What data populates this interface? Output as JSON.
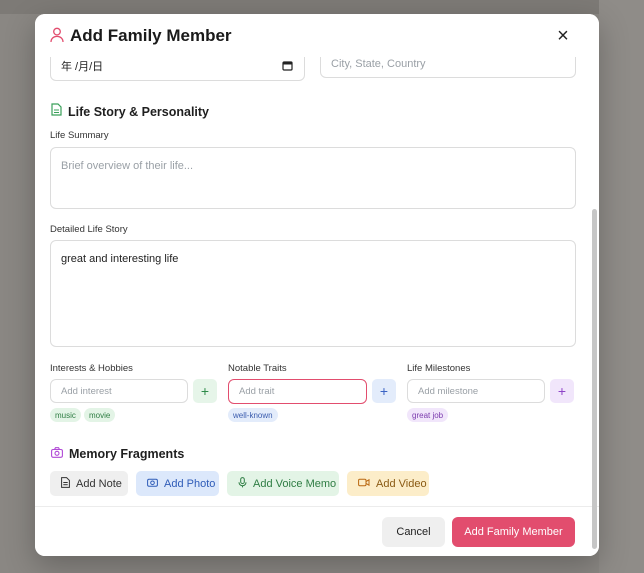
{
  "dialog": {
    "title": "Add Family Member",
    "close_label": "×"
  },
  "fields": {
    "date_value": "年 /月/日",
    "place_placeholder": "City, State, Country"
  },
  "life_story": {
    "section_title": "Life Story & Personality",
    "summary_label": "Life Summary",
    "summary_placeholder": "Brief overview of their life...",
    "detailed_label": "Detailed Life Story",
    "detailed_value": "great and interesting life"
  },
  "interests": {
    "label": "Interests & Hobbies",
    "placeholder": "Add interest",
    "add_label": "+",
    "tags": [
      "music",
      "movie"
    ]
  },
  "traits": {
    "label": "Notable Traits",
    "placeholder": "Add trait",
    "add_label": "+",
    "tags": [
      "well-known"
    ]
  },
  "milestones": {
    "label": "Life Milestones",
    "placeholder": "Add milestone",
    "add_label": "+",
    "tags": [
      "great job"
    ]
  },
  "memory": {
    "section_title": "Memory Fragments",
    "buttons": [
      "Add Note",
      "Add Photo",
      "Add Voice Memo",
      "Add Video"
    ]
  },
  "footer": {
    "cancel_label": "Cancel",
    "submit_label": "Add Family Member"
  },
  "colors": {
    "accent": "#e24d6e",
    "interest_green": "#e8f5ea",
    "trait_blue": "#e3ecfb",
    "milestone_purple": "#f1e6fb"
  }
}
